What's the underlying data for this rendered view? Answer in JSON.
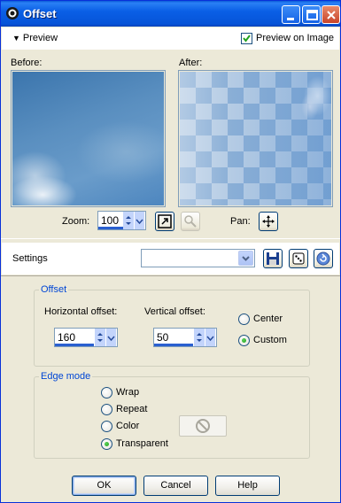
{
  "window": {
    "title": "Offset"
  },
  "titlebar_buttons": {
    "minimize": "minimize-icon",
    "maximize": "maximize-icon",
    "close": "close-icon"
  },
  "preview": {
    "toggle_label": "Preview",
    "preview_on_image_label": "Preview on Image",
    "preview_on_image_checked": true,
    "before_label": "Before:",
    "after_label": "After:",
    "zoom_label": "Zoom:",
    "zoom_value": "100",
    "pan_label": "Pan:"
  },
  "settings": {
    "label": "Settings",
    "preset_value": ""
  },
  "offset": {
    "group_title": "Offset",
    "horizontal_label": "Horizontal offset:",
    "horizontal_value": "160",
    "vertical_label": "Vertical offset:",
    "vertical_value": "50",
    "center_label": "Center",
    "custom_label": "Custom",
    "selected": "Custom"
  },
  "edge_mode": {
    "group_title": "Edge mode",
    "options": [
      "Wrap",
      "Repeat",
      "Color",
      "Transparent"
    ],
    "selected": "Transparent"
  },
  "buttons": {
    "ok": "OK",
    "cancel": "Cancel",
    "help": "Help"
  },
  "colors": {
    "title_bar": "#0a5fe6",
    "dialog_bg": "#ece9d8",
    "group_title": "#0046d5",
    "accent_bar": "#2a5fd0"
  }
}
